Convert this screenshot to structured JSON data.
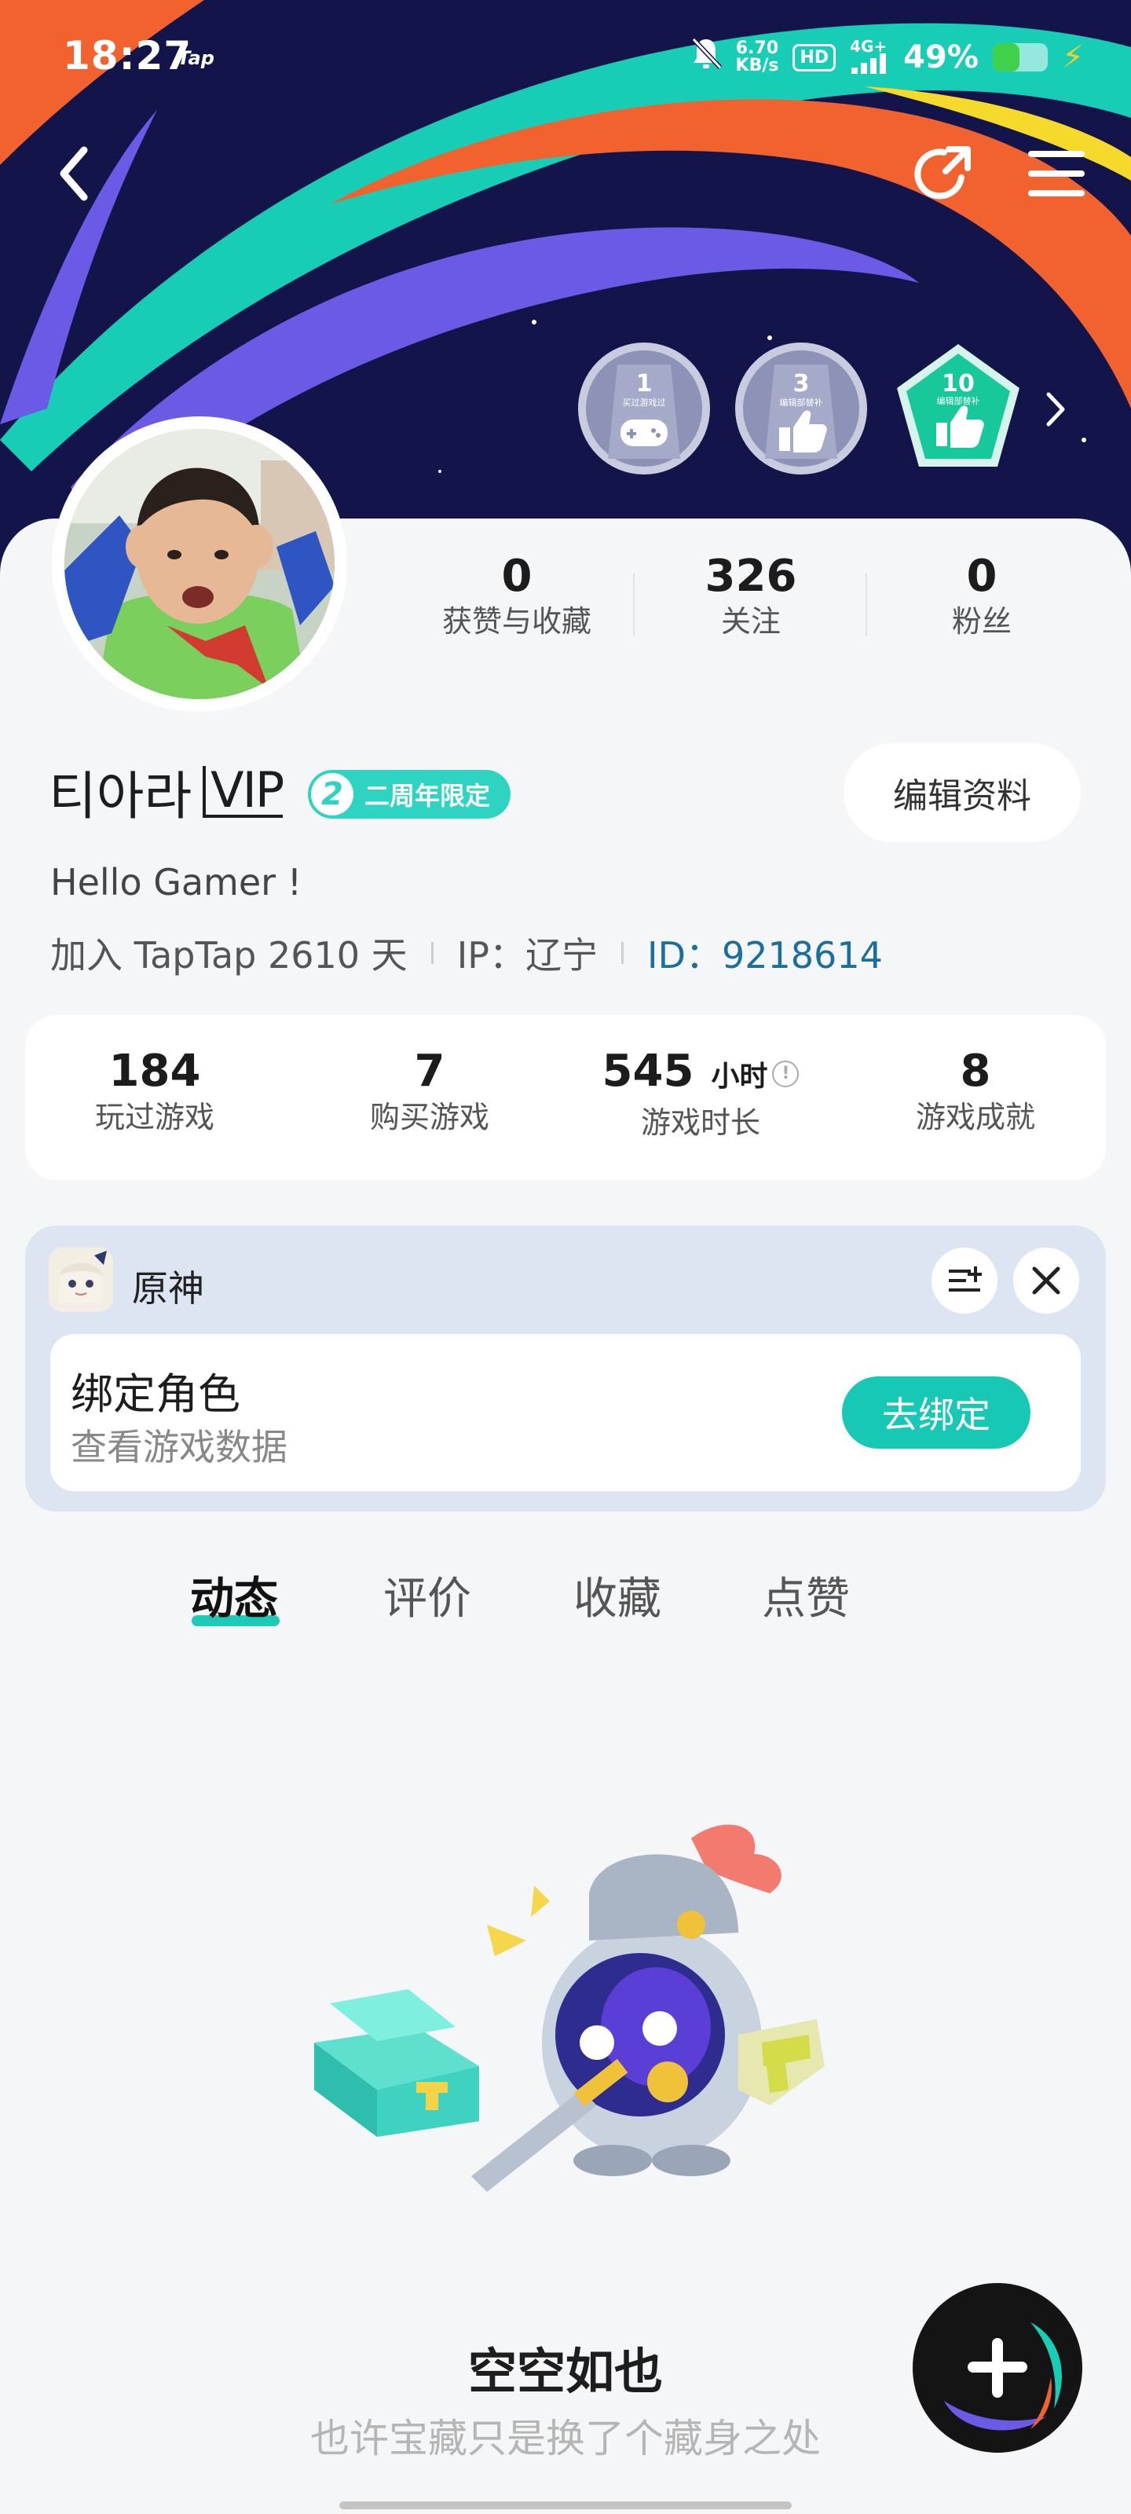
{
  "status_bar": {
    "time": "18:27",
    "app_tag": "Tap",
    "speed_value": "6.70",
    "speed_unit": "KB/s",
    "hd": "HD",
    "network": "4G+",
    "battery": "49%",
    "battery_level": 0.49
  },
  "header": {
    "back_icon": "back-arrow-icon",
    "share_icon": "share-icon",
    "menu_icon": "menu-icon"
  },
  "badges": [
    {
      "number": "1",
      "caption": "买过游戏过",
      "icon": "gamepad-icon",
      "color": "#8c93b7"
    },
    {
      "number": "3",
      "caption": "编辑部替补",
      "icon": "thumbs-up-icon",
      "color": "#8c93b7"
    },
    {
      "number": "10",
      "caption": "编辑部替补",
      "icon": "thumbs-up-icon",
      "color": "#17c99a"
    }
  ],
  "profile_stats": [
    {
      "value": "0",
      "label": "获赞与收藏"
    },
    {
      "value": "326",
      "label": "关注"
    },
    {
      "value": "0",
      "label": "粉丝"
    }
  ],
  "user": {
    "name": "티아라",
    "vip": "VIP",
    "anniversary_number": "2",
    "anniversary_label": "二周年限定",
    "edit_button": "编辑资料",
    "bio": "Hello Gamer !",
    "joined": "加入 TapTap 2610 天",
    "ip": "IP：辽宁",
    "id": "ID：9218614"
  },
  "game_stats": [
    {
      "value": "184",
      "label": "玩过游戏"
    },
    {
      "value": "7",
      "label": "购买游戏"
    },
    {
      "value": "545",
      "unit": "小时",
      "label": "游戏时长"
    },
    {
      "value": "8",
      "label": "游戏成就"
    }
  ],
  "bind_card": {
    "game_name": "原神",
    "title": "绑定角色",
    "subtitle": "查看游戏数据",
    "button": "去绑定"
  },
  "tabs": [
    {
      "label": "动态",
      "active": true
    },
    {
      "label": "评价",
      "active": false
    },
    {
      "label": "收藏",
      "active": false
    },
    {
      "label": "点赞",
      "active": false
    }
  ],
  "empty_state": {
    "title": "空空如也",
    "subtitle": "也许宝藏只是换了个藏身之处"
  },
  "colors": {
    "accent": "#17c8b5",
    "banner_bg": "#13154a",
    "id_link": "#1a6f9d"
  }
}
